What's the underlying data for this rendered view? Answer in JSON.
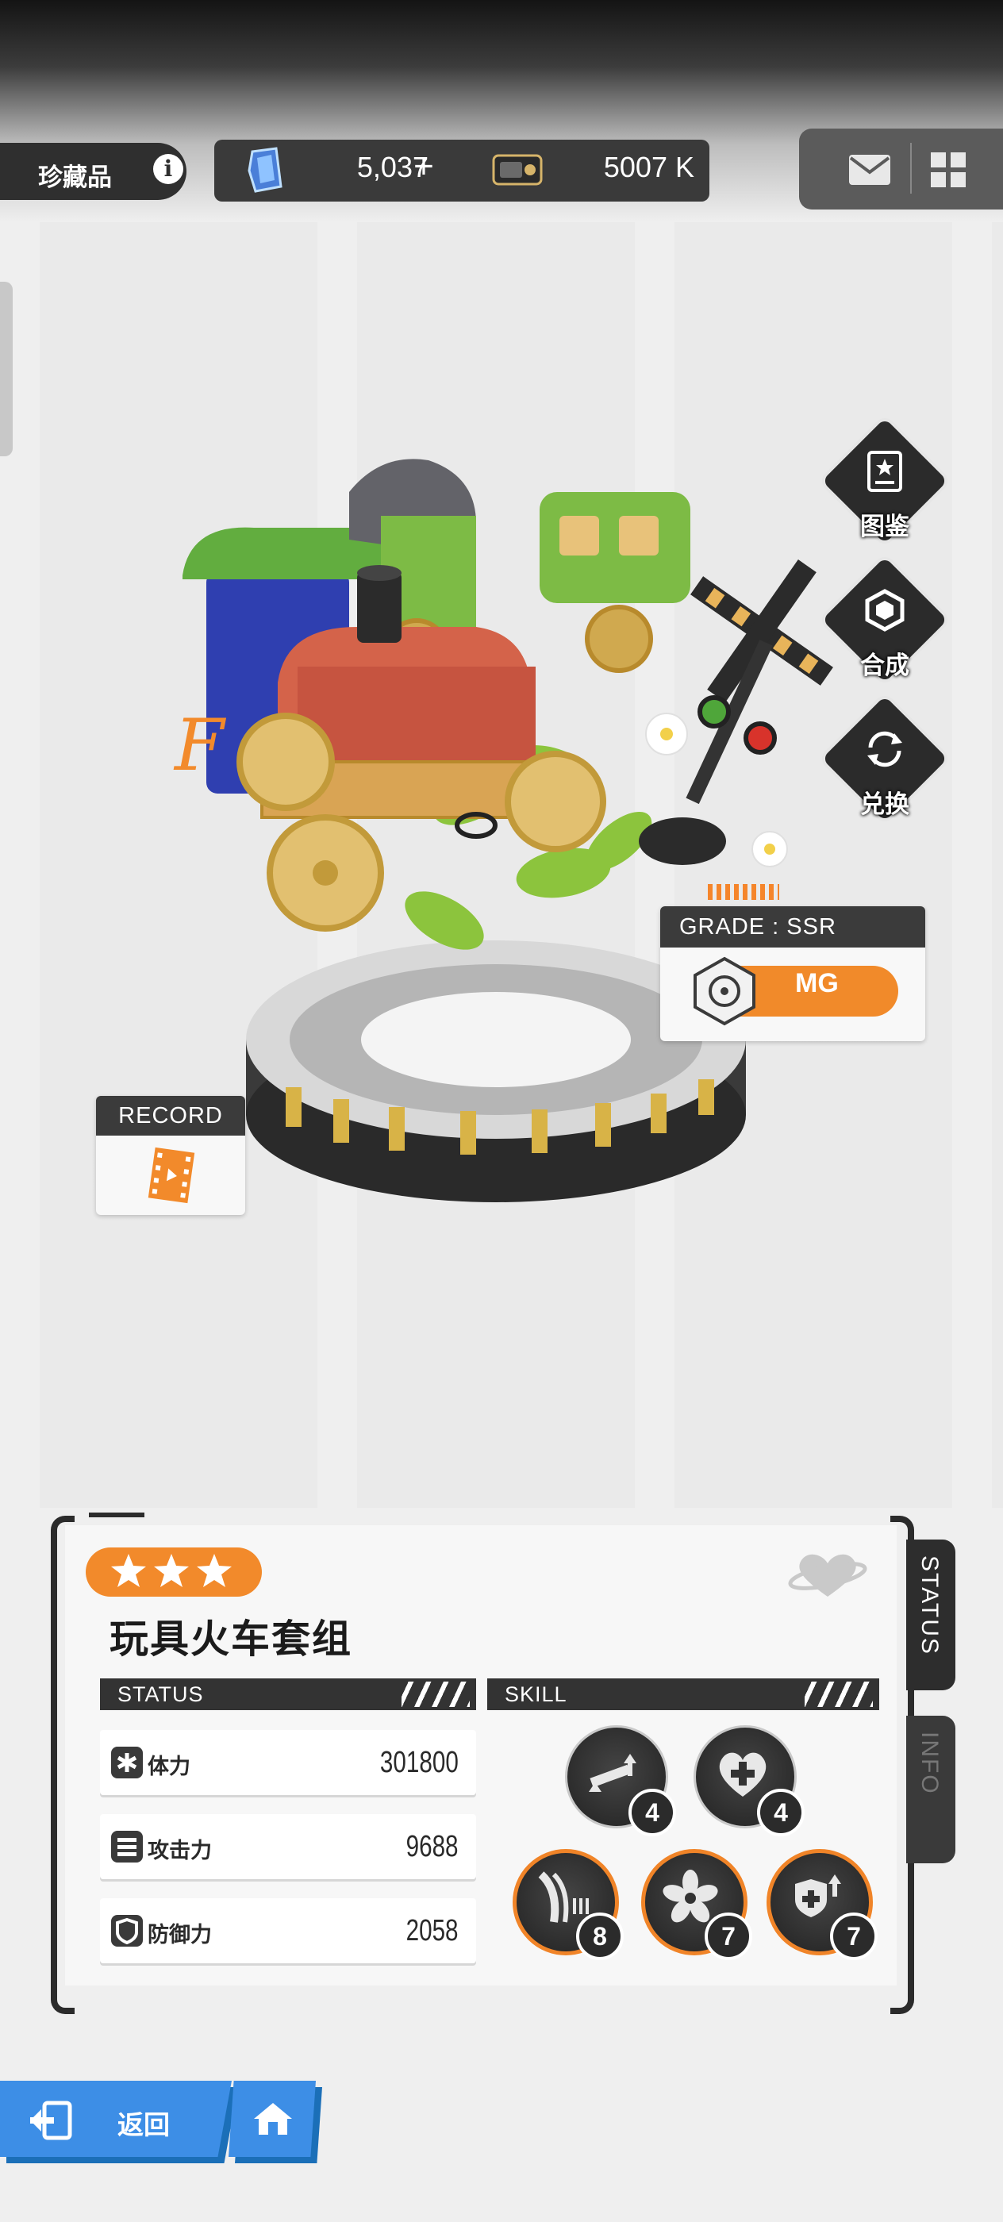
{
  "header": {
    "section_title": "珍藏品",
    "info_label": "i",
    "gems": "5,037",
    "gems_plus": "+",
    "credits": "5007 K",
    "icons": [
      "gem-icon",
      "wallet-icon",
      "mail-icon",
      "grid-menu-icon"
    ]
  },
  "side_menu": {
    "items": [
      {
        "label": "图鉴",
        "icon": "encyclopedia-icon"
      },
      {
        "label": "合成",
        "icon": "synthesis-icon"
      },
      {
        "label": "兑换",
        "icon": "exchange-icon"
      }
    ]
  },
  "grade": {
    "label": "GRADE : SSR",
    "weapon": "MG"
  },
  "record": {
    "label": "RECORD"
  },
  "item": {
    "stars": 3,
    "name": "玩具火车套组"
  },
  "status": {
    "header": "STATUS",
    "rows": [
      {
        "label": "体力",
        "value": "301800",
        "icon": "hp-icon"
      },
      {
        "label": "攻击力",
        "value": "9688",
        "icon": "attack-icon"
      },
      {
        "label": "防御力",
        "value": "2058",
        "icon": "defense-icon"
      }
    ]
  },
  "skill": {
    "header": "SKILL",
    "items": [
      {
        "level": "4",
        "icon": "weapon-up-icon"
      },
      {
        "level": "4",
        "icon": "heal-heart-icon"
      },
      {
        "level": "8",
        "icon": "ammo-icon"
      },
      {
        "level": "7",
        "icon": "flower-icon"
      },
      {
        "level": "7",
        "icon": "shield-up-icon"
      }
    ]
  },
  "tabs": {
    "status": "STATUS",
    "info": "INFO"
  },
  "footer": {
    "back": "返回"
  },
  "colors": {
    "accent_orange": "#f28a2b",
    "dark": "#2d2d2d",
    "button_blue": "#3d8ee6"
  }
}
